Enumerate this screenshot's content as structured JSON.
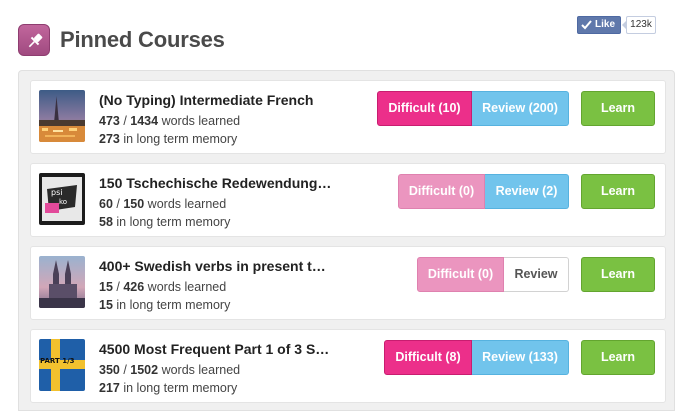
{
  "header": {
    "title": "Pinned Courses",
    "pin_icon": "pushpin-icon",
    "like": {
      "label": "Like",
      "count": "123k"
    }
  },
  "courses": [
    {
      "title": "(No Typing) Intermediate French",
      "learned": "473",
      "total": "1434",
      "words_label": "words learned",
      "long_term": "273",
      "long_term_label": "in long term memory",
      "difficult": "Difficult (10)",
      "difficult_active": true,
      "review": "Review (200)",
      "review_active": true,
      "learn": "Learn",
      "thumb": "paris-night-thumbnail"
    },
    {
      "title": "150 Tschechische Redewendung…",
      "learned": "60",
      "total": "150",
      "words_label": "words learned",
      "long_term": "58",
      "long_term_label": "in long term memory",
      "difficult": "Difficult (0)",
      "difficult_active": false,
      "review": "Review (2)",
      "review_active": true,
      "learn": "Learn",
      "thumb": "czech-book-thumbnail"
    },
    {
      "title": "400+ Swedish verbs in present t…",
      "learned": "15",
      "total": "426",
      "words_label": "words learned",
      "long_term": "15",
      "long_term_label": "in long term memory",
      "difficult": "Difficult (0)",
      "difficult_active": false,
      "review": "Review",
      "review_active": false,
      "learn": "Learn",
      "thumb": "cathedral-thumbnail"
    },
    {
      "title": "4500 Most Frequent Part 1 of 3 S…",
      "learned": "350",
      "total": "1502",
      "words_label": "words learned",
      "long_term": "217",
      "long_term_label": "in long term memory",
      "difficult": "Difficult (8)",
      "difficult_active": true,
      "review": "Review (133)",
      "review_active": true,
      "learn": "Learn",
      "thumb": "swedish-flag-thumbnail",
      "thumb_text": "PART 1/3"
    }
  ]
}
